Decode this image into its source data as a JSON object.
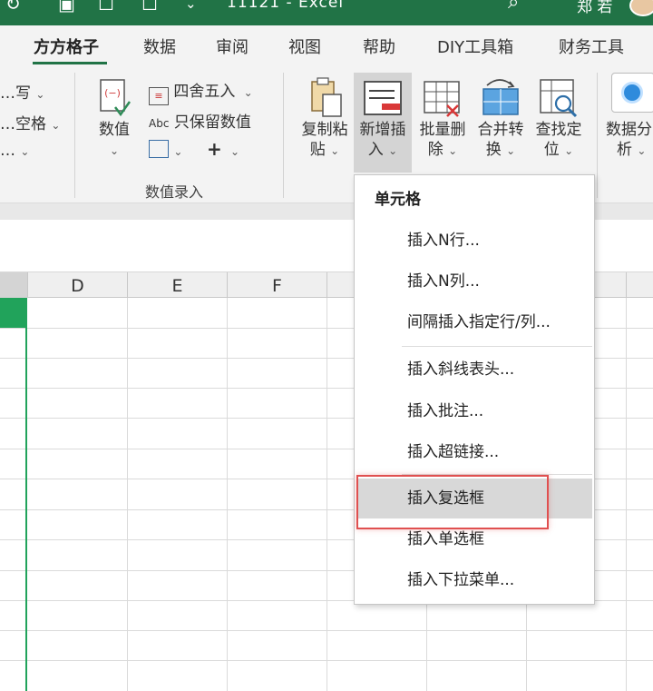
{
  "title_bar": {
    "file_title": "11121  -  Excel",
    "user_name": "郑 若"
  },
  "tabs": [
    {
      "label": "方方格子",
      "active": true
    },
    {
      "label": "数据"
    },
    {
      "label": "审阅"
    },
    {
      "label": "视图"
    },
    {
      "label": "帮助"
    },
    {
      "label": "DIY工具箱"
    },
    {
      "label": "财务工具"
    }
  ],
  "ribbon": {
    "left_partial": {
      "item1": "…写",
      "item2": "…空格",
      "item3": "…"
    },
    "numeric_group": {
      "value_button": "数值",
      "round_label": "四舍五入",
      "abc_prefix": "Abc",
      "keep_value_label": "只保留数值",
      "plus_label": "+",
      "group_label": "数值录入"
    },
    "copy_paste": {
      "line1": "复制粘",
      "line2": "贴"
    },
    "insert_new": {
      "line1": "新增插",
      "line2": "入"
    },
    "batch_delete": {
      "line1": "批量删",
      "line2": "除"
    },
    "merge_convert": {
      "line1": "合并转",
      "line2": "换"
    },
    "find_locate": {
      "line1": "查找定",
      "line2": "位"
    },
    "data_analysis": {
      "line1": "数据分",
      "line2": "析"
    }
  },
  "columns": [
    "D",
    "E",
    "F"
  ],
  "menu": {
    "header": "单元格",
    "items": [
      {
        "label": "插入N行..."
      },
      {
        "label": "插入N列..."
      },
      {
        "label": "间隔插入指定行/列..."
      },
      {
        "label": "插入斜线表头..."
      },
      {
        "label": "插入批注..."
      },
      {
        "label": "插入超链接..."
      },
      {
        "label": "插入复选框",
        "hovered": true
      },
      {
        "label": "插入单选框"
      },
      {
        "label": "插入下拉菜单..."
      }
    ]
  },
  "colors": {
    "excel_green": "#217346",
    "selection_green": "#21a35b",
    "highlight_red": "#e05050"
  }
}
